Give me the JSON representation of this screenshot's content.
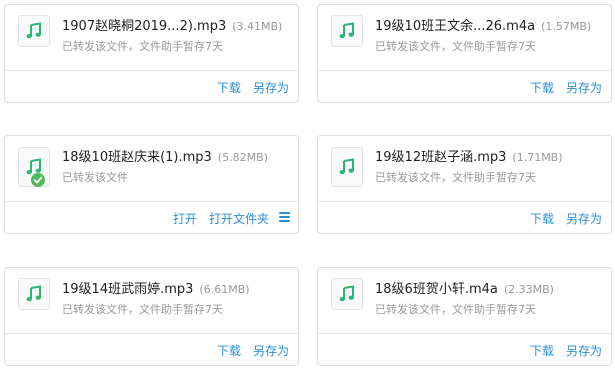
{
  "cards": [
    {
      "filename": "1907赵晓桐2019...2).mp3",
      "size": "(3.41MB)",
      "status": "已转发该文件，文件助手暂存7天",
      "actions": [
        "下载",
        "另存为"
      ],
      "icon": "music-note-icon"
    },
    {
      "filename": "19级10班王文余...26.m4a",
      "size": "(1.57MB)",
      "status": "已转发该文件，文件助手暂存7天",
      "actions": [
        "下载",
        "另存为"
      ],
      "icon": "music-note-icon"
    },
    {
      "filename": "18级10班赵庆来(1).mp3",
      "size": "(5.82MB)",
      "status": "已转发该文件",
      "actions": [
        "打开",
        "打开文件夹"
      ],
      "icon": "music-note-icon",
      "badge": "check-circle-icon"
    },
    {
      "filename": "19级12班赵子涵.mp3",
      "size": "(1.71MB)",
      "status": "已转发该文件，文件助手暂存7天",
      "actions": [
        "下载",
        "另存为"
      ],
      "icon": "music-note-icon"
    },
    {
      "filename": "19级14班武雨婷.mp3",
      "size": "(6.61MB)",
      "status": "已转发该文件，文件助手暂存7天",
      "actions": [
        "下载",
        "另存为"
      ],
      "icon": "music-note-icon"
    },
    {
      "filename": "18级6班贺小轩.m4a",
      "size": "(2.33MB)",
      "status": "已转发该文件，文件助手暂存7天",
      "actions": [
        "下载",
        "另存为"
      ],
      "icon": "music-note-icon"
    }
  ],
  "colors": {
    "accent": "#2a8fd6",
    "music_icon": "#2bb673",
    "check": "#52b95a"
  }
}
